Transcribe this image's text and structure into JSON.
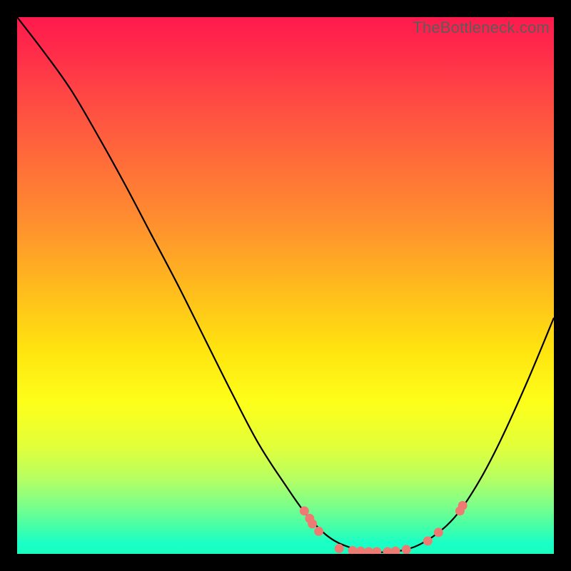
{
  "watermark": "TheBottleneck.com",
  "chart_data": {
    "type": "line",
    "title": "",
    "xlabel": "",
    "ylabel": "",
    "xlim": [
      0,
      100
    ],
    "ylim": [
      0,
      100
    ],
    "grid": false,
    "curve": [
      {
        "x": 0.0,
        "y": 100.0
      },
      {
        "x": 5.0,
        "y": 93.5
      },
      {
        "x": 10.0,
        "y": 86.5
      },
      {
        "x": 15.0,
        "y": 78.0
      },
      {
        "x": 20.0,
        "y": 69.0
      },
      {
        "x": 25.0,
        "y": 59.5
      },
      {
        "x": 30.0,
        "y": 50.0
      },
      {
        "x": 35.0,
        "y": 40.0
      },
      {
        "x": 40.0,
        "y": 30.0
      },
      {
        "x": 45.0,
        "y": 20.5
      },
      {
        "x": 50.0,
        "y": 12.8
      },
      {
        "x": 54.0,
        "y": 7.2
      },
      {
        "x": 58.0,
        "y": 3.2
      },
      {
        "x": 62.0,
        "y": 1.2
      },
      {
        "x": 66.0,
        "y": 0.4
      },
      {
        "x": 70.0,
        "y": 0.4
      },
      {
        "x": 74.0,
        "y": 1.3
      },
      {
        "x": 78.0,
        "y": 3.6
      },
      {
        "x": 82.0,
        "y": 7.4
      },
      {
        "x": 86.0,
        "y": 13.4
      },
      {
        "x": 90.0,
        "y": 21.0
      },
      {
        "x": 95.0,
        "y": 32.0
      },
      {
        "x": 100.0,
        "y": 44.0
      }
    ],
    "markers": [
      {
        "x": 53.5,
        "y": 8.0
      },
      {
        "x": 54.5,
        "y": 6.6
      },
      {
        "x": 55.0,
        "y": 5.6
      },
      {
        "x": 56.2,
        "y": 4.2
      },
      {
        "x": 60.0,
        "y": 1.0
      },
      {
        "x": 62.5,
        "y": 0.6
      },
      {
        "x": 64.0,
        "y": 0.5
      },
      {
        "x": 65.5,
        "y": 0.4
      },
      {
        "x": 67.0,
        "y": 0.4
      },
      {
        "x": 69.0,
        "y": 0.4
      },
      {
        "x": 70.5,
        "y": 0.5
      },
      {
        "x": 72.5,
        "y": 0.8
      },
      {
        "x": 76.5,
        "y": 2.4
      },
      {
        "x": 78.5,
        "y": 4.0
      },
      {
        "x": 82.5,
        "y": 8.0
      },
      {
        "x": 83.0,
        "y": 9.0
      }
    ],
    "marker_radius_px": 6.5
  }
}
